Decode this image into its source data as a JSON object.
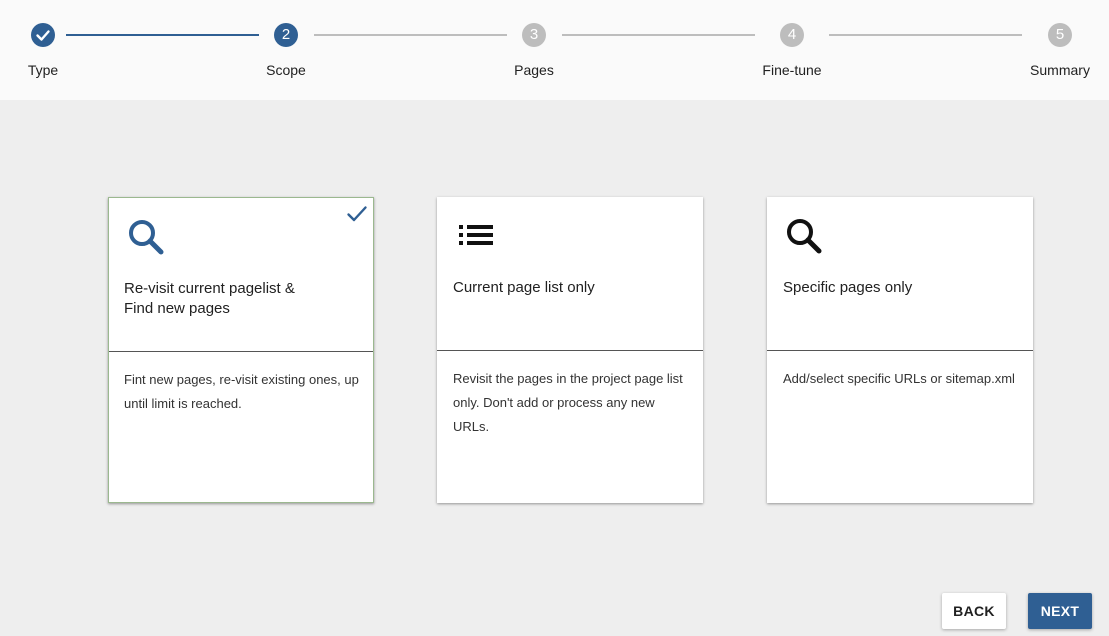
{
  "stepper": {
    "steps": [
      {
        "number": "",
        "label": "Type",
        "state": "done"
      },
      {
        "number": "2",
        "label": "Scope",
        "state": "active"
      },
      {
        "number": "3",
        "label": "Pages",
        "state": "pending"
      },
      {
        "number": "4",
        "label": "Fine-tune",
        "state": "pending"
      },
      {
        "number": "5",
        "label": "Summary",
        "state": "pending"
      }
    ],
    "icons": {
      "done": "check-icon"
    }
  },
  "options": [
    {
      "icon": "search-icon",
      "title": "Re-visit current pagelist &\nFind new pages",
      "description": "Fint new pages, re-visit existing ones, up until limit is reached.",
      "selected": true
    },
    {
      "icon": "list-icon",
      "title": "Current page list only",
      "description": "Revisit the pages in the project page list only. Don't add or process any new URLs.",
      "selected": false
    },
    {
      "icon": "search-icon",
      "title": "Specific pages only",
      "description": "Add/select specific URLs or sitemap.xml",
      "selected": false
    }
  ],
  "footer": {
    "back_label": "BACK",
    "next_label": "NEXT"
  },
  "colors": {
    "primary": "#2f5f93",
    "pending": "#bdbdbd",
    "selected_border": "#9bb88f",
    "background": "#eeeeee"
  }
}
